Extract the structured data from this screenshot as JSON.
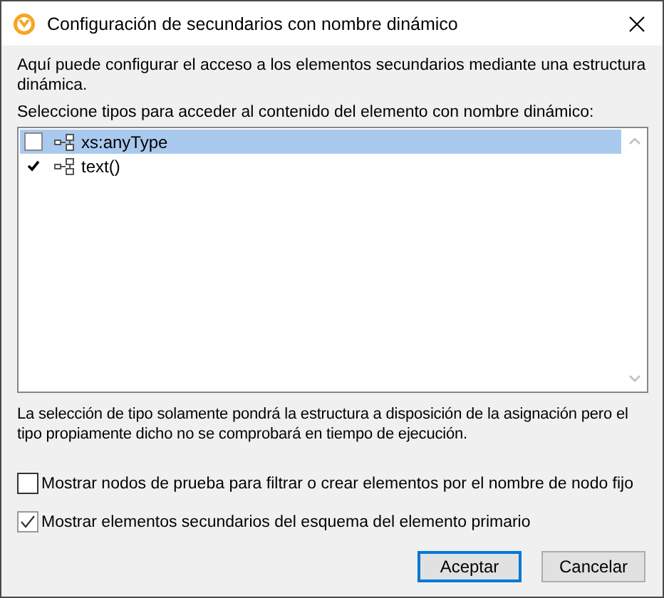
{
  "window": {
    "title": "Configuración de secundarios con nombre dinámico"
  },
  "intro": "Aquí puede configurar el acceso a los elementos secundarios mediante una estructura dinámica.",
  "list_label": "Seleccione tipos para acceder al contenido del elemento con nombre dinámico:",
  "types": [
    {
      "label": "xs:anyType",
      "checked": false,
      "selected": true
    },
    {
      "label": "text()",
      "checked": true,
      "selected": false
    }
  ],
  "note": "La selección de tipo solamente pondrá la estructura a disposición de la asignación pero el tipo propiamente dicho no se comprobará en tiempo de ejecución.",
  "options": [
    {
      "label": "Mostrar nodos de prueba para filtrar o crear elementos por el nombre de nodo fijo",
      "checked": false
    },
    {
      "label": "Mostrar elementos secundarios del esquema del elemento primario",
      "checked": true
    }
  ],
  "buttons": [
    {
      "label": "Aceptar",
      "default": true
    },
    {
      "label": "Cancelar",
      "default": false
    }
  ]
}
